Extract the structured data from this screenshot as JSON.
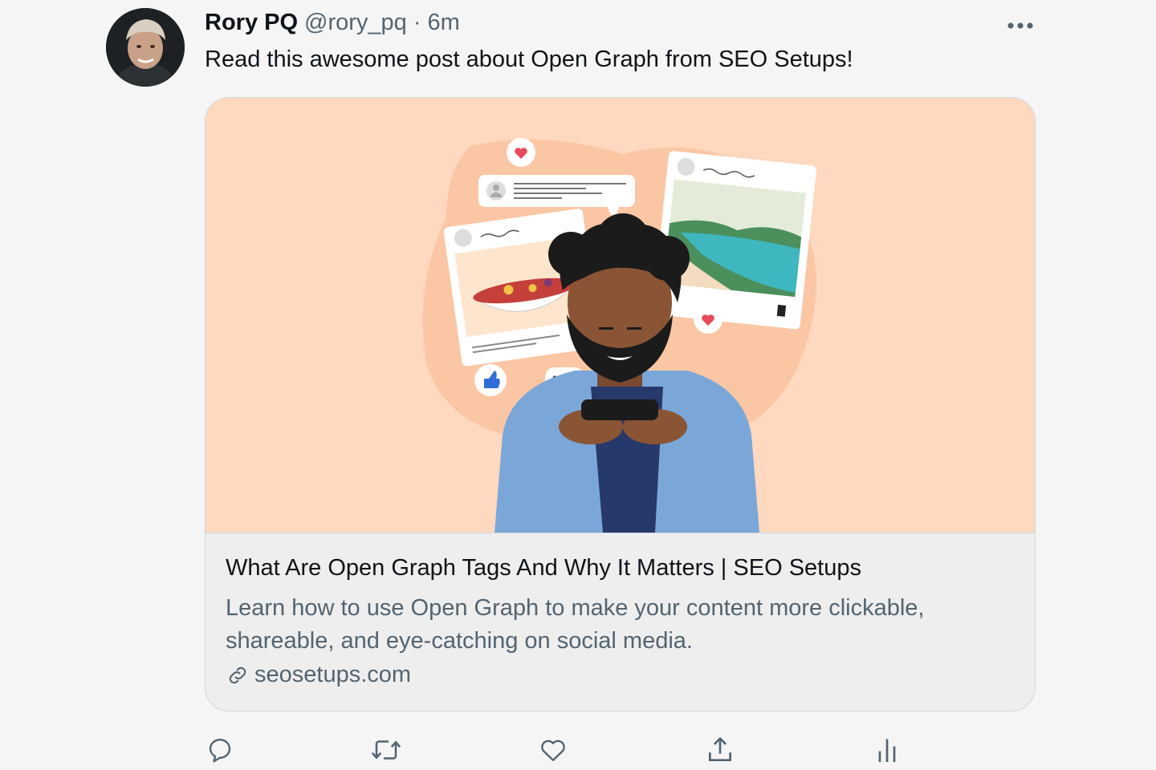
{
  "tweet": {
    "display_name": "Rory PQ",
    "handle": "@rory_pq",
    "separator": "·",
    "time": "6m",
    "text": "Read this awesome post about Open Graph from SEO Setups!",
    "more_label": "More"
  },
  "card": {
    "title": "What Are Open Graph Tags And Why It Matters | SEO Setups",
    "description": "Learn how to use Open Graph to make your content more clickable, shareable, and eye-catching on social media.",
    "domain": "seosetups.com",
    "image_background": "#fed8bf"
  },
  "actions": [
    {
      "name": "reply",
      "icon": "speech-bubble-icon"
    },
    {
      "name": "retweet",
      "icon": "retweet-arrows-icon"
    },
    {
      "name": "like",
      "icon": "heart-icon"
    },
    {
      "name": "share",
      "icon": "share-upload-icon"
    },
    {
      "name": "analytics",
      "icon": "bar-chart-icon"
    }
  ],
  "colors": {
    "text_primary": "#0f1419",
    "text_secondary": "#536471",
    "border": "#cfd9de",
    "background": "#f5f5f5"
  }
}
